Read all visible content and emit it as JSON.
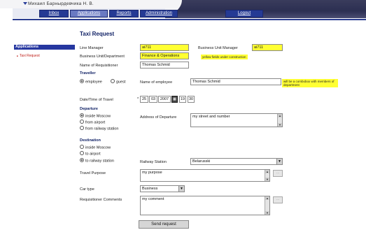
{
  "header": {
    "user_name": "Михаил Барнырдевчика Н. В.",
    "nav": [
      {
        "label": "Inbox",
        "active": false
      },
      {
        "label": "Applications",
        "active": true
      },
      {
        "label": "Reports",
        "active": false
      },
      {
        "label": "Administration",
        "active": false
      }
    ],
    "logout_label": "Logout"
  },
  "sidebar": {
    "heading": "Applications",
    "items": [
      {
        "label": "Taxi Request"
      }
    ]
  },
  "form": {
    "title": "Taxi Request",
    "line_manager_label": "Line Manager",
    "line_manager_value": "ai711",
    "bu_manager_label": "Business Unit Manager",
    "bu_manager_value": "ai711",
    "bu_dept_label": "Business Unit/Department",
    "bu_dept_value": "Finance & Operations",
    "yellow_note": "yellow fields under construction",
    "requisitioner_label": "Name of Requisitioner",
    "requisitioner_value": "Thomas Schmid",
    "traveller_heading": "Traveller",
    "employee_label": "employee",
    "guest_label": "guest",
    "employee_name_label": "Name of employee",
    "employee_name_value": "Thomas Schmid",
    "employee_note": "will be a combobox with members of department",
    "datetime_label": "Date/Time of Travel",
    "date_day": "25",
    "date_month": "03",
    "date_year": "2007",
    "time_hour": "19",
    "time_min": "30",
    "departure_heading": "Departure",
    "dep_options": [
      "inside Moscow",
      "from airport",
      "from railway station"
    ],
    "dep_address_label": "Address of Departure",
    "dep_address_value": "my street and number",
    "destination_heading": "Destination",
    "dest_options": [
      "inside Moscow",
      "to airport",
      "to railway station"
    ],
    "railway_label": "Railway Station",
    "railway_value": "Belarusski",
    "purpose_label": "Travel Purpose",
    "purpose_value": "my purpose",
    "car_type_label": "Car type",
    "car_type_value": "Business",
    "comments_label": "Requisitioner Comments",
    "comments_value": "my comment",
    "send_label": "Send request"
  },
  "colors": {
    "nav_blue": "#253a94",
    "highlight_yellow": "#ffff33",
    "side_red": "#c0201a"
  }
}
